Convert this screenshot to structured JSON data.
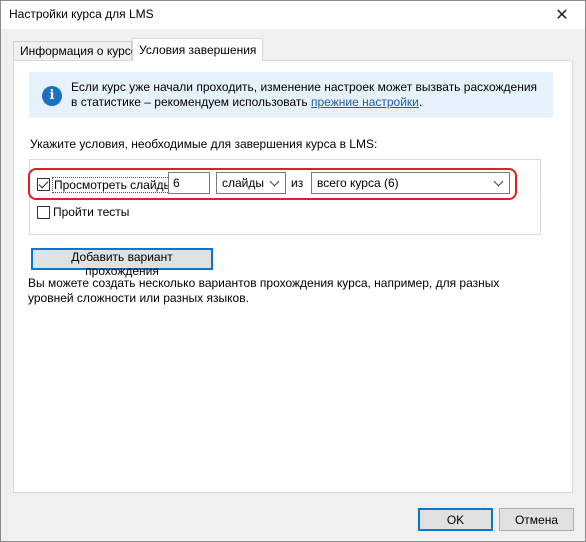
{
  "window": {
    "title": "Настройки курса для LMS",
    "close_glyph": "✕"
  },
  "tabs": [
    {
      "label": "Информация о курсе",
      "active": false
    },
    {
      "label": "Условия завершения",
      "active": true
    }
  ],
  "info": {
    "icon": "info-icon",
    "text": "Если курс уже начали проходить, изменение настроек может вызвать расхождения в статистике – рекомендуем использовать ",
    "link": "прежние настройки",
    "suffix": "."
  },
  "instruction": "Укажите условия, необходимые для завершения курса в LMS:",
  "conditions": {
    "slides": {
      "label": "Просмотреть слайды",
      "checked": true,
      "count": "6",
      "unit": "слайды",
      "of": "из",
      "scope": "всего курса (6)"
    },
    "tests": {
      "label": "Пройти тесты",
      "checked": false
    }
  },
  "add_button": "Добавить вариант прохождения",
  "hint": "Вы можете создать несколько вариантов прохождения курса, например, для разных уровней сложности или разных языков.",
  "footer": {
    "ok": "OK",
    "cancel": "Отмена"
  },
  "colors": {
    "accent": "#0078d7",
    "highlight": "#e02020",
    "info_bg": "#e6f2fb",
    "link": "#1f5ea8"
  }
}
